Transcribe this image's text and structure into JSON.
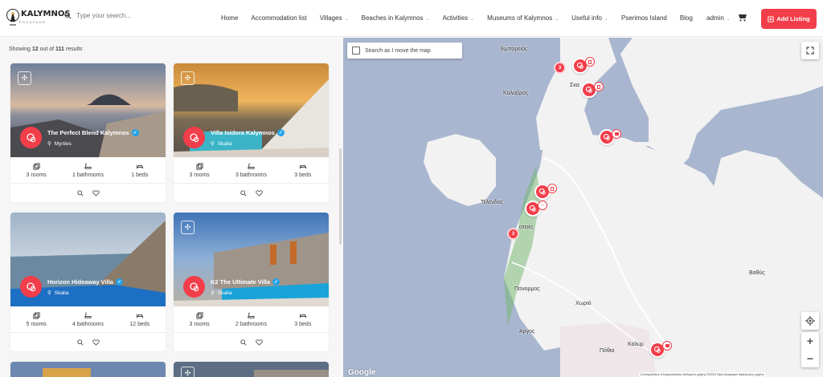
{
  "brand": {
    "name": "KALYMNOS",
    "tagline": "ESCAPADE"
  },
  "search": {
    "placeholder": "Type your search..."
  },
  "nav": [
    {
      "label": "Home",
      "dropdown": false
    },
    {
      "label": "Accommodation list",
      "dropdown": false
    },
    {
      "label": "Villages",
      "dropdown": true
    },
    {
      "label": "Beaches in Kalymnos",
      "dropdown": true
    },
    {
      "label": "Activities",
      "dropdown": true
    },
    {
      "label": "Museums of Kalymnos",
      "dropdown": true
    },
    {
      "label": "Useful info",
      "dropdown": true
    },
    {
      "label": "Pserimos Island",
      "dropdown": false
    },
    {
      "label": "Blog",
      "dropdown": false
    }
  ],
  "user": {
    "name": "admin"
  },
  "add_listing": "Add Listing",
  "results": {
    "prefix": "Showing",
    "shown": "12",
    "middle": "out of",
    "total": "111",
    "suffix": "results"
  },
  "cards": [
    {
      "title": "The Perfect Blend Kalymnos",
      "location": "Myrties",
      "rooms": "3 rooms",
      "bathrooms": "1 bathrooms",
      "beds": "1 beds"
    },
    {
      "title": "Villa Isidora Kalymnos",
      "location": "Skalia",
      "rooms": "3 rooms",
      "bathrooms": "3 bathrooms",
      "beds": "3 beds"
    },
    {
      "title": "Horizon Hideaway Villa",
      "location": "Skalia",
      "rooms": "5 rooms",
      "bathrooms": "4 bathrooms",
      "beds": "12 beds"
    },
    {
      "title": "K2 The Ultimate Villa",
      "location": "Skalia",
      "rooms": "3 rooms",
      "bathrooms": "2 bathrooms",
      "beds": "3 beds"
    }
  ],
  "map": {
    "search_move": "Search as I move the map",
    "labels": [
      "Εμπορειός",
      "Καλαβρός",
      "Σκα",
      "Τέλενδος",
      "οτειές",
      "Πανορμος",
      "Χωριό",
      "Βαθύς",
      "Άργος",
      "Πόθια",
      "Καλυμ"
    ],
    "clusters": [
      "3",
      "3"
    ],
    "google": "Google",
    "attribution": "Συντομεύσεις πληκτρολογίου   Δεδομένα χάρτη ©2024   Όροι   Αναφορά σφάλματος χάρτη"
  },
  "colors": {
    "accent": "#f23e4a",
    "verified": "#22a3e8",
    "land": "#f2f2f2",
    "water": "#a9b6cf"
  }
}
